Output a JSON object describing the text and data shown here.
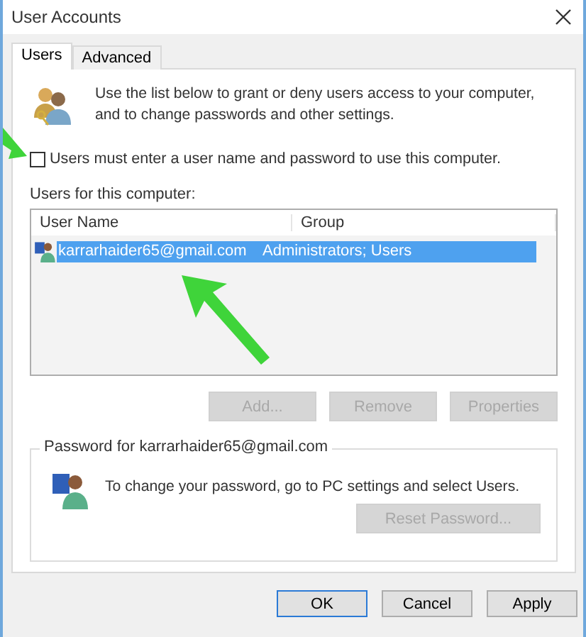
{
  "window": {
    "title": "User Accounts"
  },
  "tabs": [
    {
      "label": "Users",
      "selected": true
    },
    {
      "label": "Advanced",
      "selected": false
    }
  ],
  "intro": "Use the list below to grant or deny users access to your computer, and to change passwords and other settings.",
  "require_password": {
    "label": "Users must enter a user name and password to use this computer.",
    "checked": false
  },
  "users_list": {
    "label": "Users for this computer:",
    "columns": [
      "User Name",
      "Group"
    ],
    "rows": [
      {
        "user_name": "karrarhaider65@gmail.com",
        "group": "Administrators; Users",
        "selected": true
      }
    ]
  },
  "list_buttons": [
    {
      "label": "Add...",
      "disabled": true
    },
    {
      "label": "Remove",
      "disabled": true
    },
    {
      "label": "Properties",
      "disabled": true
    }
  ],
  "password_group": {
    "title": "Password for karrarhaider65@gmail.com",
    "text": "To change your password, go to PC settings and select Users.",
    "button": {
      "label": "Reset Password...",
      "disabled": true
    }
  },
  "buttons": [
    {
      "label": "OK",
      "default": true
    },
    {
      "label": "Cancel",
      "default": false
    },
    {
      "label": "Apply",
      "default": false
    }
  ]
}
